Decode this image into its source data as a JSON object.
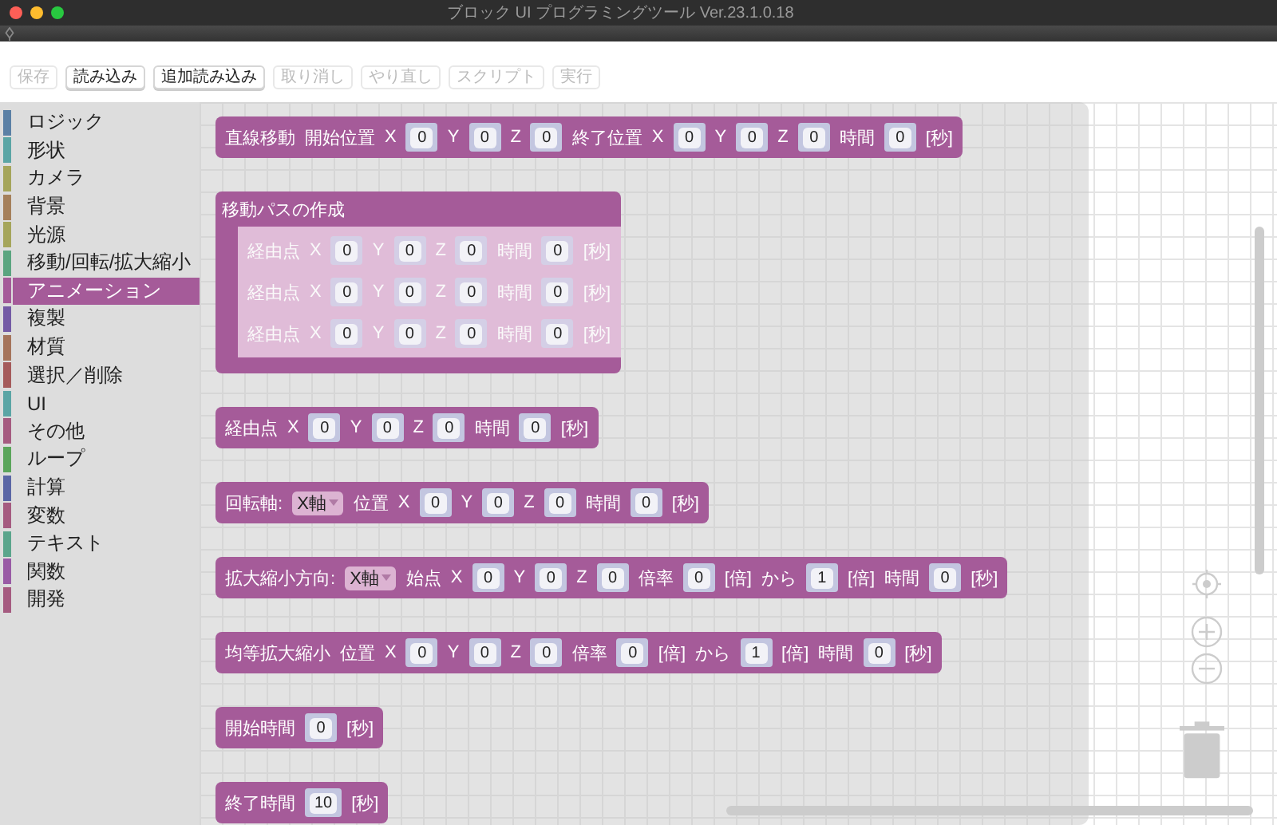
{
  "window": {
    "title": "ブロック UI プログラミングツール Ver.23.1.0.18"
  },
  "toolbar": [
    {
      "label": "保存",
      "disabled": true
    },
    {
      "label": "読み込み",
      "disabled": false
    },
    {
      "label": "追加読み込み",
      "disabled": false
    },
    {
      "label": "取り消し",
      "disabled": true
    },
    {
      "label": "やり直し",
      "disabled": true
    },
    {
      "label": "スクリプト",
      "disabled": true
    },
    {
      "label": "実行",
      "disabled": true
    }
  ],
  "categories": [
    {
      "label": "ロジック",
      "color": "#5b80a5",
      "selected": false
    },
    {
      "label": "形状",
      "color": "#5ba5a5",
      "selected": false
    },
    {
      "label": "カメラ",
      "color": "#a5a55b",
      "selected": false
    },
    {
      "label": "背景",
      "color": "#a5805b",
      "selected": false
    },
    {
      "label": "光源",
      "color": "#a5a55b",
      "selected": false
    },
    {
      "label": "移動/回転/拡大縮小",
      "color": "#5ba580",
      "selected": false
    },
    {
      "label": "アニメーション",
      "color": "#a55b99",
      "selected": true
    },
    {
      "label": "複製",
      "color": "#745ba5",
      "selected": false
    },
    {
      "label": "材質",
      "color": "#a5745b",
      "selected": false
    },
    {
      "label": "選択／削除",
      "color": "#a55b5b",
      "selected": false
    },
    {
      "label": "UI",
      "color": "#5ba5a5",
      "selected": false
    },
    {
      "label": "その他",
      "color": "#a55b80",
      "selected": false
    },
    {
      "label": "ループ",
      "color": "#5ba55b",
      "selected": false
    },
    {
      "label": "計算",
      "color": "#5b67a5",
      "selected": false
    },
    {
      "label": "変数",
      "color": "#a55b80",
      "selected": false
    },
    {
      "label": "テキスト",
      "color": "#5ba58c",
      "selected": false
    },
    {
      "label": "関数",
      "color": "#995ba5",
      "selected": false
    },
    {
      "label": "開発",
      "color": "#a55b80",
      "selected": false
    }
  ],
  "blocks": [
    {
      "kind": "row",
      "parts": [
        {
          "kind": "label",
          "text": "直線移動"
        },
        {
          "kind": "label",
          "text": "開始位置"
        },
        {
          "kind": "label",
          "text": "X"
        },
        {
          "kind": "input",
          "text": "0"
        },
        {
          "kind": "label",
          "text": "Y"
        },
        {
          "kind": "input",
          "text": "0"
        },
        {
          "kind": "label",
          "text": "Z"
        },
        {
          "kind": "input",
          "text": "0"
        },
        {
          "kind": "label",
          "text": "終了位置"
        },
        {
          "kind": "label",
          "text": "X"
        },
        {
          "kind": "input",
          "text": "0"
        },
        {
          "kind": "label",
          "text": "Y"
        },
        {
          "kind": "input",
          "text": "0"
        },
        {
          "kind": "label",
          "text": "Z"
        },
        {
          "kind": "input",
          "text": "0"
        },
        {
          "kind": "label",
          "text": "時間"
        },
        {
          "kind": "input",
          "text": "0"
        },
        {
          "kind": "label",
          "text": "[秒]"
        }
      ]
    },
    {
      "kind": "container",
      "title": "移動パスの作成",
      "children": [
        {
          "kind": "row",
          "faded": true,
          "parts": [
            {
              "kind": "label",
              "text": "経由点"
            },
            {
              "kind": "label",
              "text": "X"
            },
            {
              "kind": "input",
              "text": "0"
            },
            {
              "kind": "label",
              "text": "Y"
            },
            {
              "kind": "input",
              "text": "0"
            },
            {
              "kind": "label",
              "text": "Z"
            },
            {
              "kind": "input",
              "text": "0"
            },
            {
              "kind": "label",
              "text": "時間"
            },
            {
              "kind": "input",
              "text": "0"
            },
            {
              "kind": "label",
              "text": "[秒]"
            }
          ]
        },
        {
          "kind": "row",
          "faded": true,
          "parts": [
            {
              "kind": "label",
              "text": "経由点"
            },
            {
              "kind": "label",
              "text": "X"
            },
            {
              "kind": "input",
              "text": "0"
            },
            {
              "kind": "label",
              "text": "Y"
            },
            {
              "kind": "input",
              "text": "0"
            },
            {
              "kind": "label",
              "text": "Z"
            },
            {
              "kind": "input",
              "text": "0"
            },
            {
              "kind": "label",
              "text": "時間"
            },
            {
              "kind": "input",
              "text": "0"
            },
            {
              "kind": "label",
              "text": "[秒]"
            }
          ]
        },
        {
          "kind": "row",
          "faded": true,
          "parts": [
            {
              "kind": "label",
              "text": "経由点"
            },
            {
              "kind": "label",
              "text": "X"
            },
            {
              "kind": "input",
              "text": "0"
            },
            {
              "kind": "label",
              "text": "Y"
            },
            {
              "kind": "input",
              "text": "0"
            },
            {
              "kind": "label",
              "text": "Z"
            },
            {
              "kind": "input",
              "text": "0"
            },
            {
              "kind": "label",
              "text": "時間"
            },
            {
              "kind": "input",
              "text": "0"
            },
            {
              "kind": "label",
              "text": "[秒]"
            }
          ]
        }
      ]
    },
    {
      "kind": "row",
      "parts": [
        {
          "kind": "label",
          "text": "経由点"
        },
        {
          "kind": "label",
          "text": "X"
        },
        {
          "kind": "input",
          "text": "0"
        },
        {
          "kind": "label",
          "text": "Y"
        },
        {
          "kind": "input",
          "text": "0"
        },
        {
          "kind": "label",
          "text": "Z"
        },
        {
          "kind": "input",
          "text": "0"
        },
        {
          "kind": "label",
          "text": "時間"
        },
        {
          "kind": "input",
          "text": "0"
        },
        {
          "kind": "label",
          "text": "[秒]"
        }
      ]
    },
    {
      "kind": "row",
      "parts": [
        {
          "kind": "label",
          "text": "回転軸:"
        },
        {
          "kind": "dropdown",
          "text": "X軸"
        },
        {
          "kind": "label",
          "text": "位置"
        },
        {
          "kind": "label",
          "text": "X"
        },
        {
          "kind": "input",
          "text": "0"
        },
        {
          "kind": "label",
          "text": "Y"
        },
        {
          "kind": "input",
          "text": "0"
        },
        {
          "kind": "label",
          "text": "Z"
        },
        {
          "kind": "input",
          "text": "0"
        },
        {
          "kind": "label",
          "text": "時間"
        },
        {
          "kind": "input",
          "text": "0"
        },
        {
          "kind": "label",
          "text": "[秒]"
        }
      ]
    },
    {
      "kind": "row",
      "parts": [
        {
          "kind": "label",
          "text": "拡大縮小方向:"
        },
        {
          "kind": "dropdown",
          "text": "X軸"
        },
        {
          "kind": "label",
          "text": "始点"
        },
        {
          "kind": "label",
          "text": "X"
        },
        {
          "kind": "input",
          "text": "0"
        },
        {
          "kind": "label",
          "text": "Y"
        },
        {
          "kind": "input",
          "text": "0"
        },
        {
          "kind": "label",
          "text": "Z"
        },
        {
          "kind": "input",
          "text": "0"
        },
        {
          "kind": "label",
          "text": "倍率"
        },
        {
          "kind": "input",
          "text": "0"
        },
        {
          "kind": "label",
          "text": "[倍]"
        },
        {
          "kind": "label",
          "text": "から"
        },
        {
          "kind": "input",
          "text": "1"
        },
        {
          "kind": "label",
          "text": "[倍]"
        },
        {
          "kind": "label",
          "text": "時間"
        },
        {
          "kind": "input",
          "text": "0"
        },
        {
          "kind": "label",
          "text": "[秒]"
        }
      ]
    },
    {
      "kind": "row",
      "parts": [
        {
          "kind": "label",
          "text": "均等拡大縮小"
        },
        {
          "kind": "label",
          "text": "位置"
        },
        {
          "kind": "label",
          "text": "X"
        },
        {
          "kind": "input",
          "text": "0"
        },
        {
          "kind": "label",
          "text": "Y"
        },
        {
          "kind": "input",
          "text": "0"
        },
        {
          "kind": "label",
          "text": "Z"
        },
        {
          "kind": "input",
          "text": "0"
        },
        {
          "kind": "label",
          "text": "倍率"
        },
        {
          "kind": "input",
          "text": "0"
        },
        {
          "kind": "label",
          "text": "[倍]"
        },
        {
          "kind": "label",
          "text": "から"
        },
        {
          "kind": "input",
          "text": "1"
        },
        {
          "kind": "label",
          "text": "[倍]"
        },
        {
          "kind": "label",
          "text": "時間"
        },
        {
          "kind": "input",
          "text": "0"
        },
        {
          "kind": "label",
          "text": "[秒]"
        }
      ]
    },
    {
      "kind": "row",
      "parts": [
        {
          "kind": "label",
          "text": "開始時間"
        },
        {
          "kind": "input",
          "text": "0"
        },
        {
          "kind": "label",
          "text": "[秒]"
        }
      ]
    },
    {
      "kind": "row",
      "parts": [
        {
          "kind": "label",
          "text": "終了時間"
        },
        {
          "kind": "input",
          "text": "10"
        },
        {
          "kind": "label",
          "text": "[秒]"
        }
      ]
    }
  ]
}
